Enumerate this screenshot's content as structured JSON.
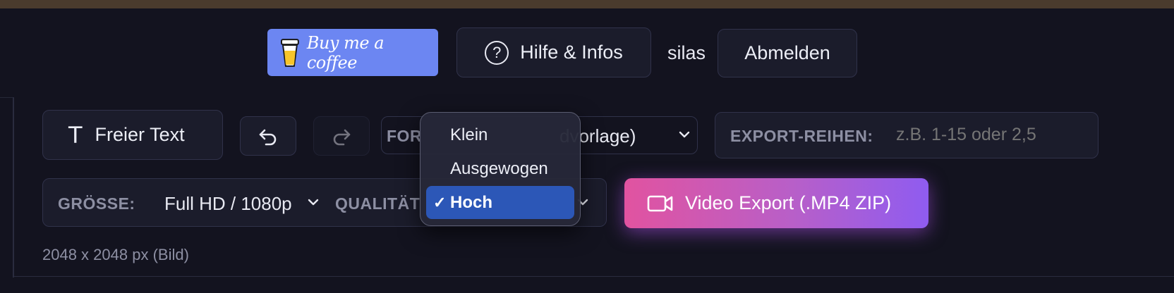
{
  "header": {
    "coffee_label": "Buy me a coffee",
    "help_label": "Hilfe & Infos",
    "username": "silas",
    "logout_label": "Abmelden"
  },
  "toolbar": {
    "free_text_label": "Freier Text",
    "format_label": "FOR",
    "format_value": "dvorlage)",
    "export_rows_label": "EXPORT-REIHEN:",
    "export_rows_placeholder": "z.B. 1-15 oder 2,5",
    "export_rows_value": ""
  },
  "export": {
    "size_label": "GRÖSSE:",
    "size_value": "Full HD / 1080p",
    "quality_label": "QUALITÄT",
    "video_button_label": "Video Export (.MP4 ZIP)",
    "dimensions": "2048 x 2048 px (Bild)"
  },
  "quality_dropdown": {
    "options": [
      "Klein",
      "Ausgewogen",
      "Hoch"
    ],
    "selected": "Hoch",
    "check_glyph": "✓"
  },
  "colors": {
    "accent_blue": "#6c86f2",
    "selection": "#2c57b7",
    "video_gradient_start": "#e153a0",
    "video_gradient_end": "#8f5cf0"
  }
}
